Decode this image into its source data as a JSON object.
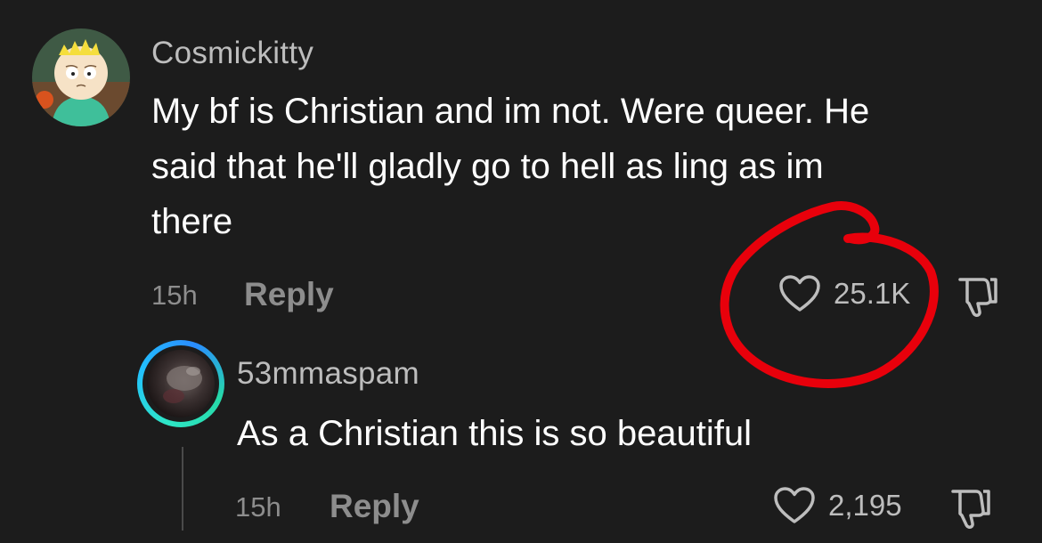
{
  "comment": {
    "username": "Cosmickitty",
    "text_lines": [
      "My bf is Christian and im not. Were queer. He",
      "said that he'll gladly go to hell as ling as im",
      "there"
    ],
    "time": "15h",
    "reply_label": "Reply",
    "likes": "25.1K",
    "avatar_icon": "butters-cartoon-avatar"
  },
  "reply": {
    "username": "53mmaspam",
    "text": "As a Christian this is so beautiful",
    "time": "15h",
    "reply_label": "Reply",
    "likes": "2,195",
    "avatar_ring_color": "#2ee6c7"
  },
  "icons": {
    "like": "heart-outline-icon",
    "dislike": "thumbs-down-outline-icon"
  },
  "colors": {
    "background": "#1c1c1c",
    "annotation": "#e8000b"
  }
}
